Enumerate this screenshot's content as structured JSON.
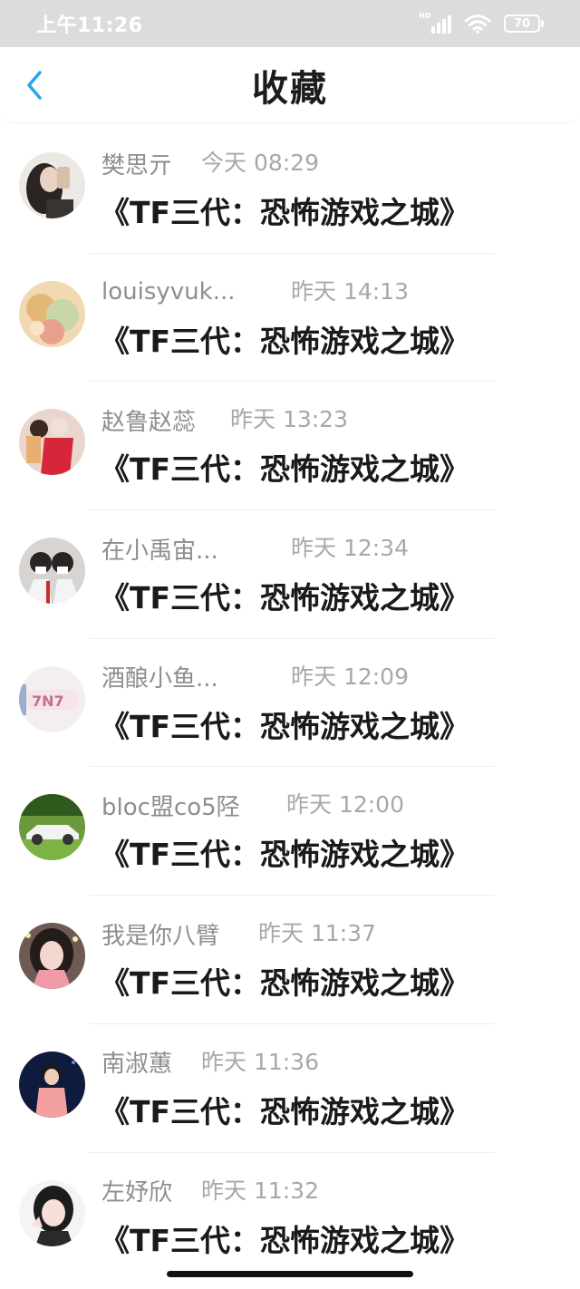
{
  "status_bar": {
    "time": "上午11:26",
    "hd_label": "HD",
    "battery": "70",
    "icons": [
      "signal-icon",
      "wifi-icon",
      "battery-icon"
    ]
  },
  "header": {
    "back_icon": "chevron-left-icon",
    "title": "收藏",
    "accent": "#2aa3e8"
  },
  "favorites": [
    {
      "author": "樊思亓",
      "time": "今天 08:29",
      "title": "《TF三代：恐怖游戏之城》"
    },
    {
      "author": "louisyvuk...",
      "time": "昨天 14:13",
      "title": "《TF三代：恐怖游戏之城》"
    },
    {
      "author": "赵鲁赵蕊",
      "time": "昨天 13:23",
      "title": "《TF三代：恐怖游戏之城》"
    },
    {
      "author": "在小禹宙...",
      "time": "昨天 12:34",
      "title": "《TF三代：恐怖游戏之城》"
    },
    {
      "author": "酒酿小鱼...",
      "time": "昨天 12:09",
      "title": "《TF三代：恐怖游戏之城》"
    },
    {
      "author": "bloc盟co5陉",
      "time": "昨天 12:00",
      "title": "《TF三代：恐怖游戏之城》"
    },
    {
      "author": "我是你八臂",
      "time": "昨天 11:37",
      "title": "《TF三代：恐怖游戏之城》"
    },
    {
      "author": "南淑蕙",
      "time": "昨天 11:36",
      "title": "《TF三代：恐怖游戏之城》"
    },
    {
      "author": "左妤欣",
      "time": "昨天 11:32",
      "title": "《TF三代：恐怖游戏之城》"
    }
  ]
}
